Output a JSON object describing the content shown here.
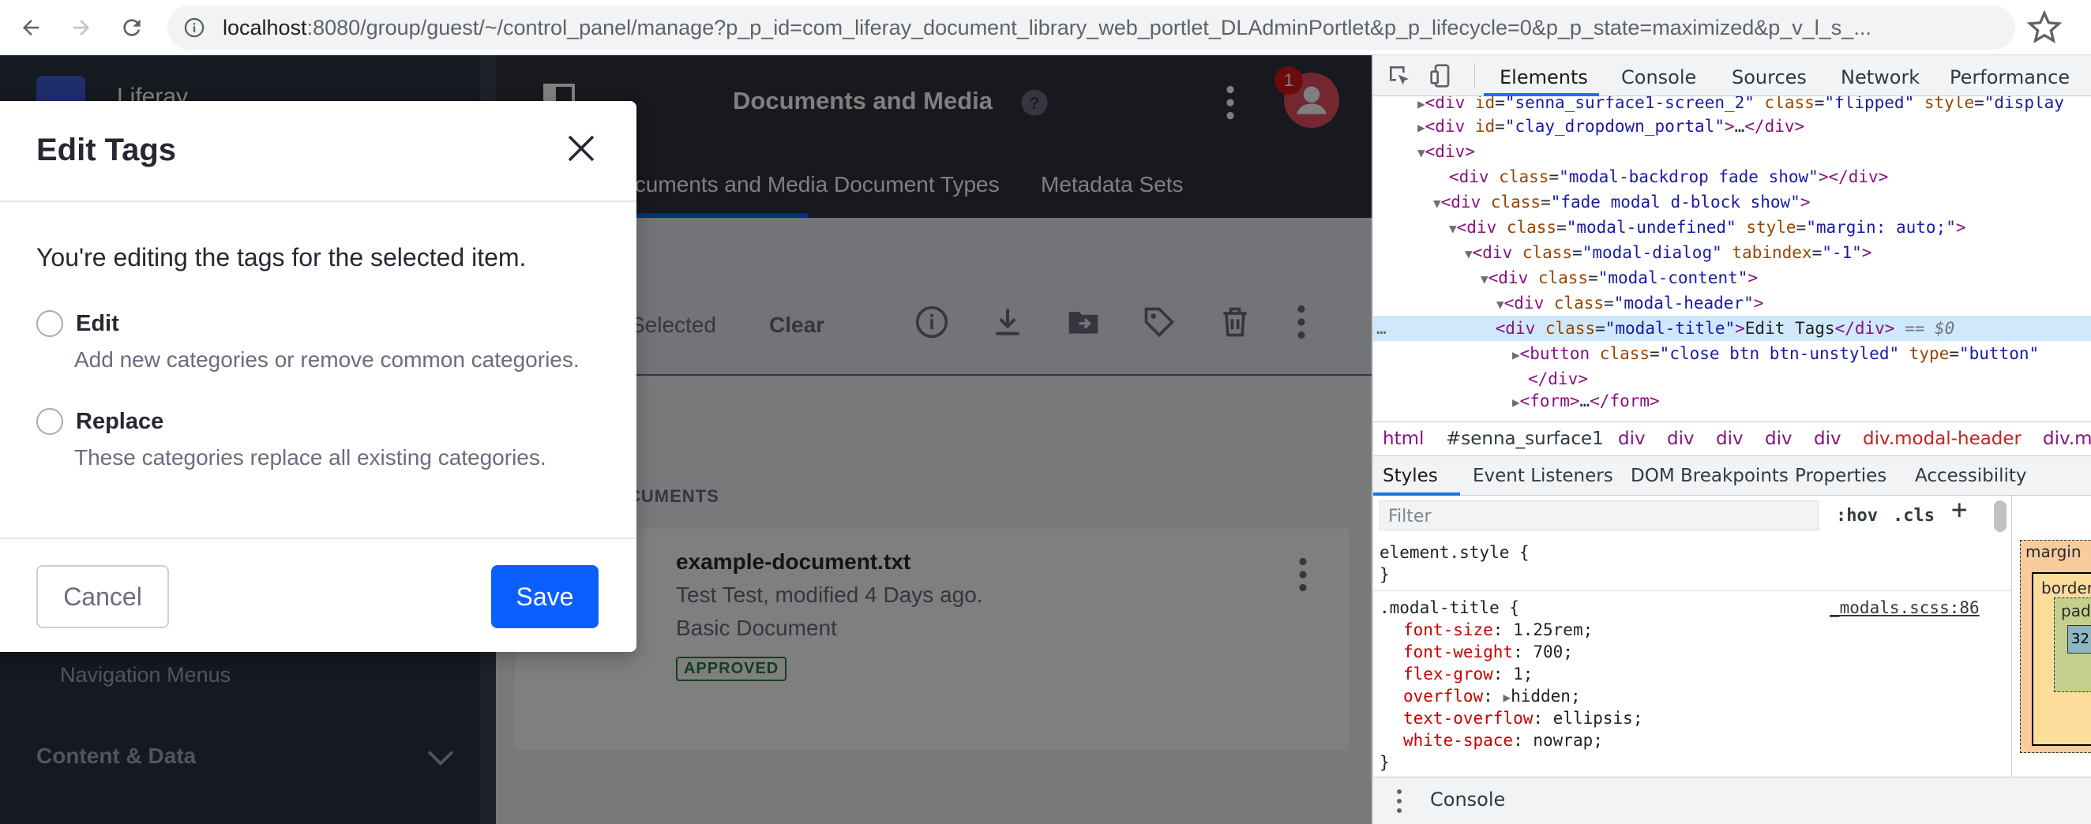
{
  "browser": {
    "url_host": "localhost",
    "url_rest": ":8080/group/guest/~/control_panel/manage?p_p_id=com_liferay_document_library_web_portlet_DLAdminPortlet&p_p_lifecycle=0&p_p_state=maximized&p_v_l_s_..."
  },
  "app": {
    "product_name": "Liferay",
    "title": "Documents and Media",
    "notification_count": "1",
    "tabs": [
      "Documents and Media",
      "Document Types",
      "Metadata Sets"
    ],
    "toolbar": {
      "selected_text": "Selected",
      "clear_label": "Clear"
    },
    "section_label": "DOCUMENTS",
    "document": {
      "title": "example-document.txt",
      "modified": "Test Test, modified 4 Days ago.",
      "type": "Basic Document",
      "status": "APPROVED"
    },
    "sidebar": {
      "link": "Navigation Menus",
      "section": "Content & Data"
    }
  },
  "modal": {
    "title": "Edit Tags",
    "intro": "You're editing the tags for the selected item.",
    "options": [
      {
        "label": "Edit",
        "help": "Add new categories or remove common categories."
      },
      {
        "label": "Replace",
        "help": "These categories replace all existing categories."
      }
    ],
    "cancel_label": "Cancel",
    "save_label": "Save"
  },
  "devtools": {
    "tabs": [
      "Elements",
      "Console",
      "Sources",
      "Network",
      "Performance"
    ],
    "breadcrumbs": [
      "html",
      "#senna_surface1",
      "div",
      "div",
      "div",
      "div",
      "div",
      "div.modal-header",
      "div.m"
    ],
    "subtabs": [
      "Styles",
      "Event Listeners",
      "DOM Breakpoints",
      "Properties",
      "Accessibility"
    ],
    "filter_placeholder": "Filter",
    "hov": ":hov",
    "cls": ".cls",
    "element_style": "element.style {",
    "rule_selector": ".modal-title {",
    "rule_source": "_modals.scss:86",
    "declarations": [
      {
        "prop": "font-size",
        "value": "1.25rem;"
      },
      {
        "prop": "font-weight",
        "value": "700;"
      },
      {
        "prop": "flex-grow",
        "value": "1;"
      },
      {
        "prop": "overflow",
        "value": "hidden;"
      },
      {
        "prop": "text-overflow",
        "value": "ellipsis;"
      },
      {
        "prop": "white-space",
        "value": "nowrap;"
      }
    ],
    "box_model": {
      "margin": "margin",
      "border": "border",
      "padding": "padding",
      "content": "32"
    },
    "drawer_label": "Console",
    "selected_equals": "== $0"
  }
}
